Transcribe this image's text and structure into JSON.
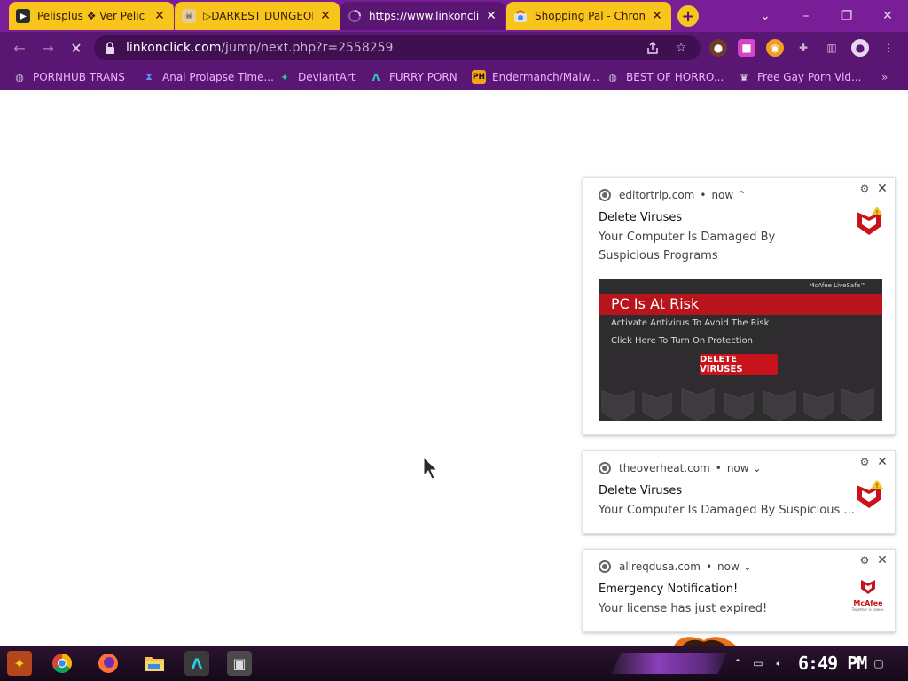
{
  "tabs": [
    {
      "title": "Pelisplus ❖ Ver Pelic",
      "close": "✕",
      "favicon": "pelisplus-icon"
    },
    {
      "title": "▷DARKEST DUNGEON",
      "close": "✕",
      "favicon": "pirate-icon"
    },
    {
      "title": "https://www.linkonclic",
      "close": "✕",
      "favicon": "loading-icon",
      "active": true
    },
    {
      "title": "Shopping Pal - Chrome",
      "close": "✕",
      "favicon": "chrome-store-icon"
    }
  ],
  "new_tab": "+",
  "window": {
    "minimize": "–",
    "restore": "❐",
    "close": "✕",
    "tab_search": "⌄"
  },
  "nav": {
    "back": "←",
    "forward": "→",
    "reload": "✕"
  },
  "omnibox": {
    "domain": "linkonclick.com",
    "path": "/jump/next.php?r=2558259"
  },
  "bookmarks": [
    {
      "label": "PORNHUB TRANS",
      "icon": "globe-icon"
    },
    {
      "label": "Anal Prolapse Time...",
      "icon": "hourglass-icon"
    },
    {
      "label": "DeviantArt",
      "icon": "deviantart-icon"
    },
    {
      "label": "FURRY PORN",
      "icon": "a-logo-icon"
    },
    {
      "label": "Endermanch/Malw...",
      "icon": "ph-icon"
    },
    {
      "label": "BEST OF HORRO...",
      "icon": "globe-icon"
    },
    {
      "label": "Free Gay Porn Vid...",
      "icon": "cake-icon"
    }
  ],
  "bookmarks_more": "»",
  "ph_label": "PH",
  "notifications": [
    {
      "site": "editortrip.com",
      "time": "now",
      "chevron": "⌃",
      "title": "Delete Viruses",
      "body": "Your Computer Is Damaged By Suspicious Programs",
      "banner": {
        "badge": "McAfee LiveSafe™",
        "headline": "PC Is At Risk",
        "line1": "Activate Antivirus To Avoid The Risk",
        "line2": "Click Here To Turn On Protection",
        "button": "DELETE VIRUSES"
      }
    },
    {
      "site": "theoverheat.com",
      "time": "now",
      "chevron": "⌄",
      "title": "Delete Viruses",
      "body": "Your Computer Is Damaged By Suspicious ..."
    },
    {
      "site": "allreqdusa.com",
      "time": "now",
      "chevron": "⌄",
      "title": "Emergency Notification!",
      "body": "Your  license has just expired!",
      "logo_text": "McAfee",
      "logo_tagline": "Together is power."
    }
  ],
  "notif_gear": "⚙",
  "notif_close": "✕",
  "dot_sep": "•",
  "taskbar": {
    "clock": "6:49 PM",
    "apps": [
      "start-icon",
      "chrome-icon",
      "firefox-icon",
      "folder-icon",
      "arch-icon",
      "screenshot-icon"
    ]
  },
  "colors": {
    "tabstrip": "#7a1e97",
    "toolbar": "#5a1673",
    "tab_yellow": "#f7c51b",
    "bookmark_text": "#f0b4ff",
    "mcafee_red": "#c8131c"
  }
}
